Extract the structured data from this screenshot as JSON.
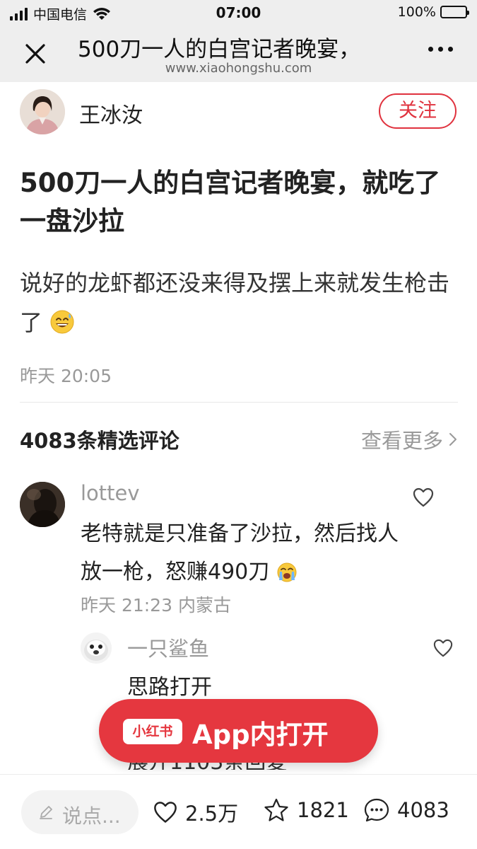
{
  "status_bar": {
    "carrier": "中国电信",
    "time": "07:00",
    "battery": "100%"
  },
  "nav": {
    "title": "500刀一人的白宫记者晚宴，",
    "url": "www.xiaohongshu.com"
  },
  "author": {
    "name": "王冰汝",
    "follow_label": "关注"
  },
  "post": {
    "title": "500刀一人的白宫记者晚宴，就吃了一盘沙拉",
    "body": "说好的龙虾都还没来得及摆上来就发生枪击了",
    "time": "昨天 20:05"
  },
  "comments": {
    "header": "4083条精选评论",
    "view_more": "查看更多",
    "items": [
      {
        "user": "lottev",
        "text": "老特就是只准备了沙拉，然后找人放一枪，怒赚490刀",
        "meta": "昨天 21:23 内蒙古",
        "replies": [
          {
            "user": "一只鲨鱼",
            "text": "思路打开"
          }
        ],
        "more_replies_partial": "展开1103条回复"
      }
    ]
  },
  "open_app": {
    "logo_text": "小红书",
    "label": "App内打开"
  },
  "bottom_bar": {
    "comment_placeholder": "说点...",
    "likes": "2.5万",
    "collects": "1821",
    "comments": "4083"
  },
  "colors": {
    "brand_red": "#e5373f",
    "follow_red": "#e0323e",
    "muted_gray": "#999999",
    "chrome_bg": "#eeeeee"
  }
}
